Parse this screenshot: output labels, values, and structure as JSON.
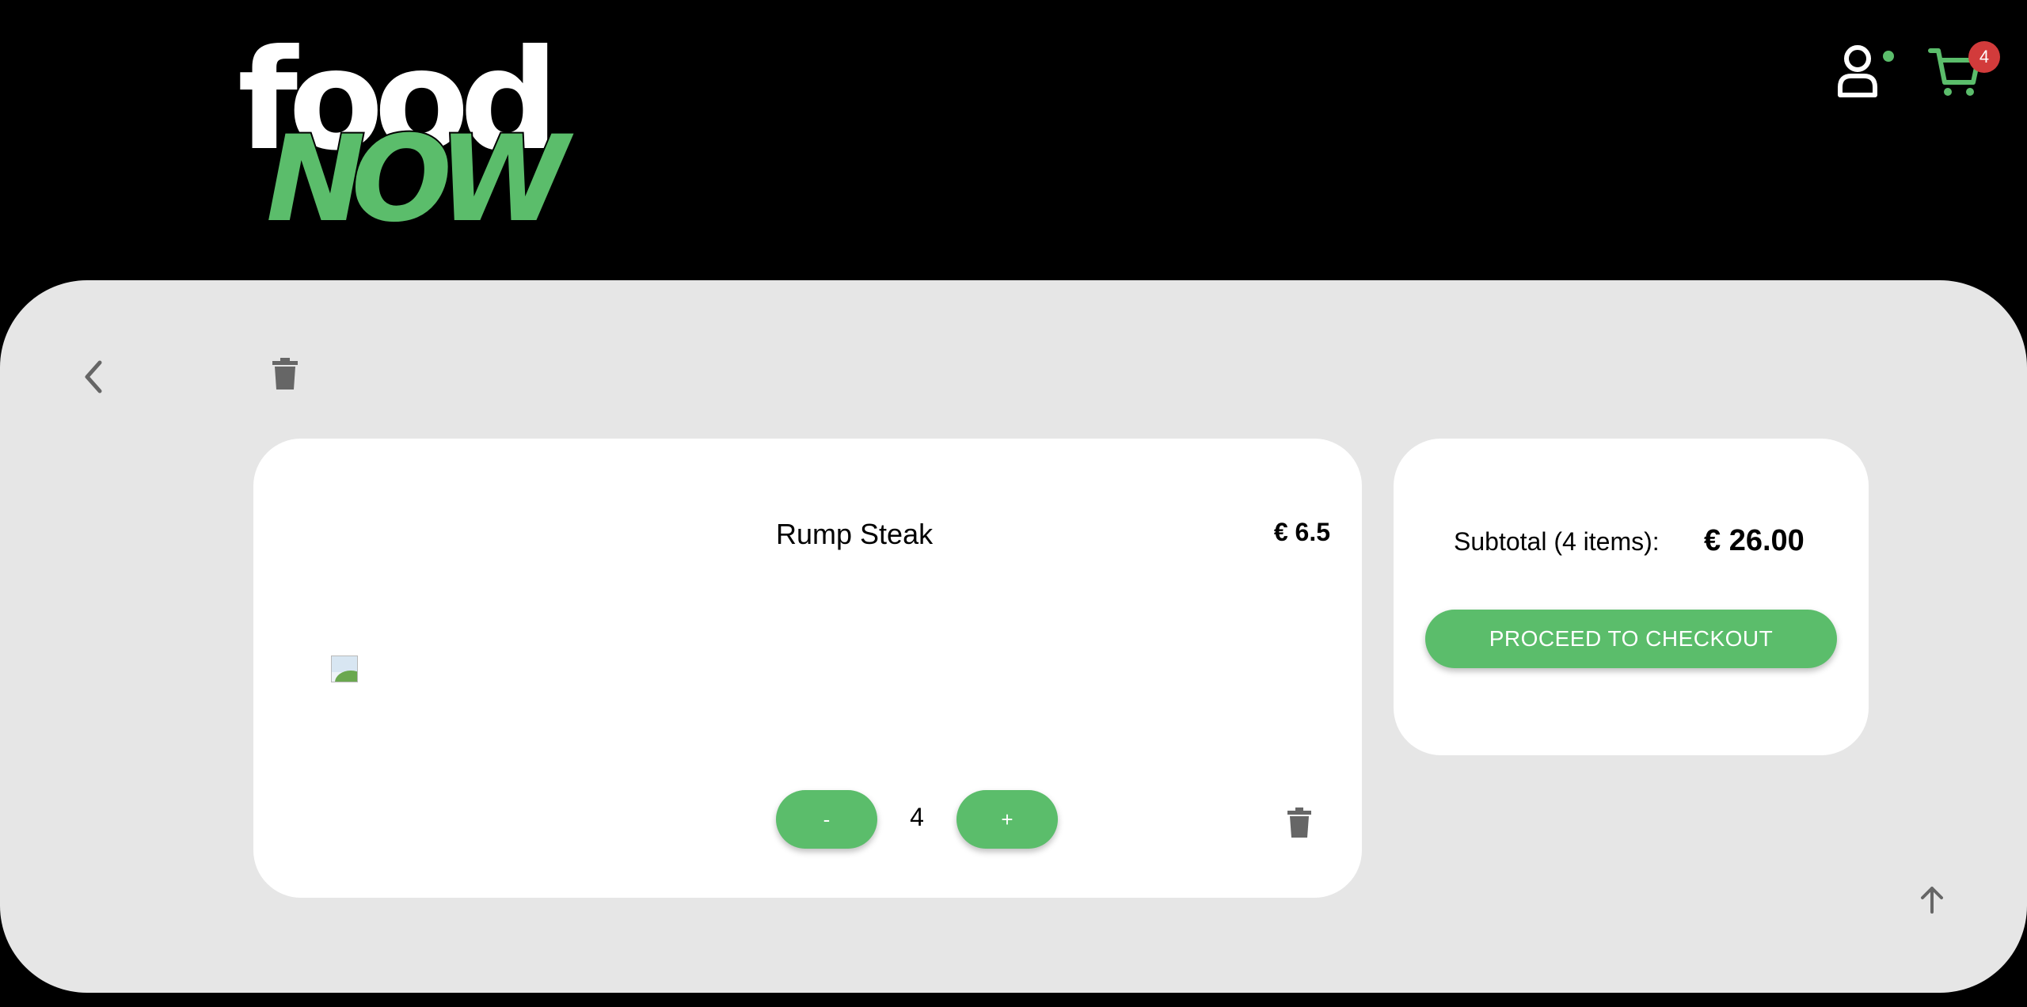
{
  "colors": {
    "accent": "#5bbd6b",
    "header_bg": "#000000",
    "panel_bg": "#e6e6e6",
    "card_bg": "#ffffff",
    "badge": "#d23b3b",
    "icon_gray": "#666666",
    "online_dot": "#5bbd6b"
  },
  "header": {
    "logo": {
      "top_text": "food",
      "bottom_text": "NOW"
    },
    "user_icon": "user-icon",
    "cart_icon": "cart-icon",
    "cart_count": "4"
  },
  "toolbar": {
    "back_icon": "chevron-left-icon",
    "clear_icon": "trash-icon"
  },
  "cart": {
    "items": [
      {
        "name": "Rump Steak",
        "price": "€ 6.5",
        "quantity": "4",
        "decrement_label": "-",
        "increment_label": "+",
        "image_icon": "broken-image-icon",
        "delete_icon": "trash-icon"
      }
    ]
  },
  "summary": {
    "subtotal_label": "Subtotal (4 items):",
    "subtotal_value": "€ 26.00",
    "checkout_label": "PROCEED TO CHECKOUT"
  },
  "scroll_top_icon": "arrow-up-icon"
}
